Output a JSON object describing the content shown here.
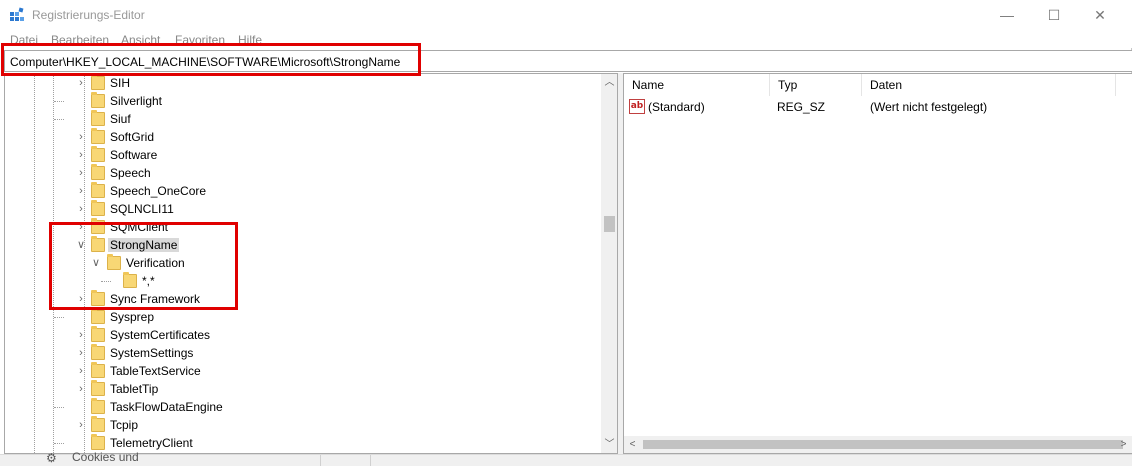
{
  "window": {
    "title": "Registrierungs-Editor",
    "controls": {
      "minimize": "—",
      "maximize": "☐",
      "close": "✕"
    }
  },
  "menu": [
    "Datei",
    "Bearbeiten",
    "Ansicht",
    "Favoriten",
    "Hilfe"
  ],
  "address": {
    "path": "Computer\\HKEY_LOCAL_MACHINE\\SOFTWARE\\Microsoft\\StrongName"
  },
  "tree": {
    "rows": [
      {
        "label": "SIH",
        "expander": ">",
        "level": 0
      },
      {
        "label": "Silverlight",
        "expander": "",
        "level": 0
      },
      {
        "label": "Siuf",
        "expander": "",
        "level": 0
      },
      {
        "label": "SoftGrid",
        "expander": ">",
        "level": 0
      },
      {
        "label": "Software",
        "expander": ">",
        "level": 0
      },
      {
        "label": "Speech",
        "expander": ">",
        "level": 0
      },
      {
        "label": "Speech_OneCore",
        "expander": ">",
        "level": 0
      },
      {
        "label": "SQLNCLI11",
        "expander": ">",
        "level": 0
      },
      {
        "label": "SQMClient",
        "expander": ">",
        "level": 0
      },
      {
        "label": "StrongName",
        "expander": "v",
        "level": 0,
        "selected": true
      },
      {
        "label": "Verification",
        "expander": "v",
        "level": 1
      },
      {
        "label": "*,*",
        "expander": "",
        "level": 2
      },
      {
        "label": "Sync Framework",
        "expander": ">",
        "level": 0
      },
      {
        "label": "Sysprep",
        "expander": "",
        "level": 0
      },
      {
        "label": "SystemCertificates",
        "expander": ">",
        "level": 0
      },
      {
        "label": "SystemSettings",
        "expander": ">",
        "level": 0
      },
      {
        "label": "TableTextService",
        "expander": ">",
        "level": 0
      },
      {
        "label": "TabletTip",
        "expander": ">",
        "level": 0
      },
      {
        "label": "TaskFlowDataEngine",
        "expander": "",
        "level": 0
      },
      {
        "label": "Tcpip",
        "expander": ">",
        "level": 0
      },
      {
        "label": "TelemetryClient",
        "expander": "",
        "level": 0
      }
    ]
  },
  "list": {
    "columns": [
      "Name",
      "Typ",
      "Daten"
    ],
    "rows": [
      {
        "icon": "ab",
        "name": "(Standard)",
        "type": "REG_SZ",
        "data": "(Wert nicht festgelegt)"
      }
    ]
  },
  "background": {
    "text": "Cookies und"
  },
  "colors": {
    "highlight": "#e00000",
    "folder": "#f8d775"
  },
  "icons": {
    "app": "registry-editor-icon",
    "folder": "folder-icon",
    "value": "string-value-icon",
    "gear": "gear-icon"
  }
}
